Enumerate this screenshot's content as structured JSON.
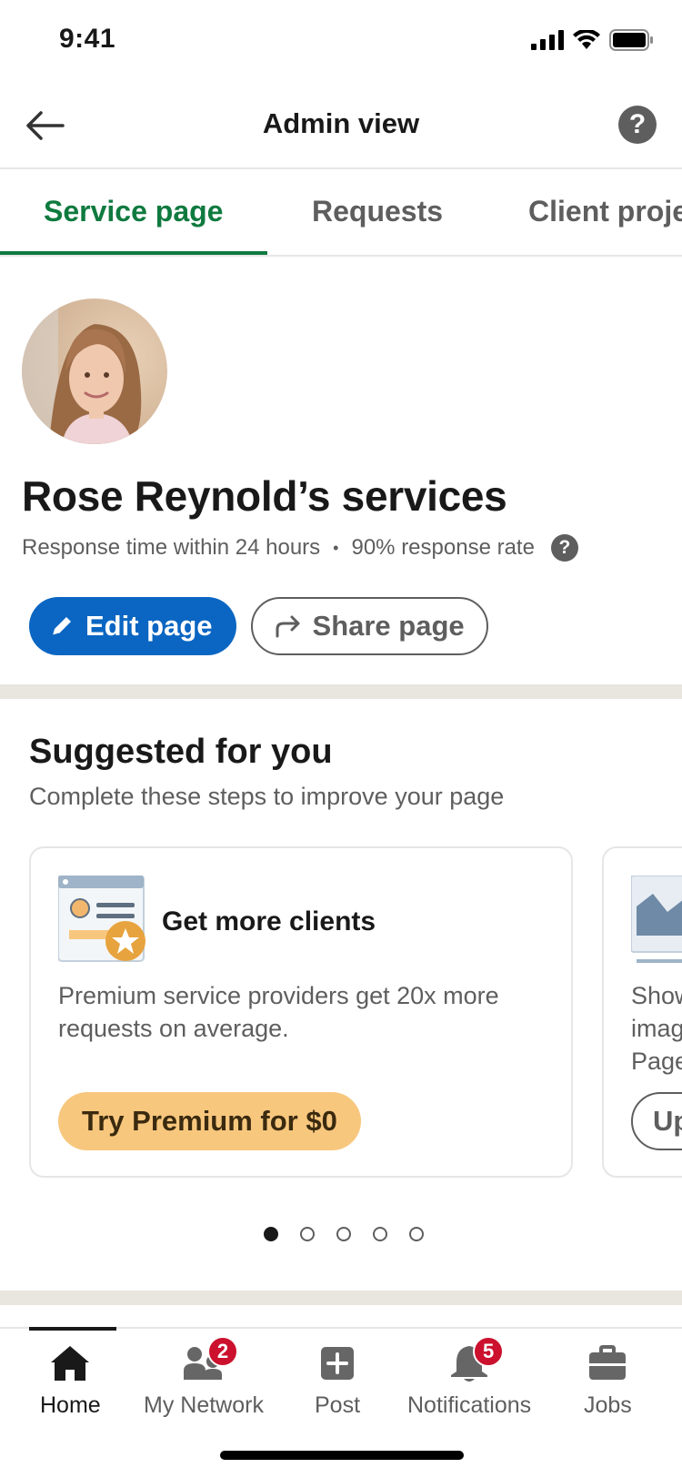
{
  "status_bar": {
    "time": "9:41"
  },
  "header": {
    "title": "Admin view"
  },
  "tabs": [
    {
      "label": "Service page"
    },
    {
      "label": "Requests"
    },
    {
      "label": "Client proje"
    }
  ],
  "profile": {
    "title": "Rose Reynold’s services",
    "response_time": "Response time within 24 hours",
    "separator": "•",
    "response_rate": "90% response rate",
    "edit_label": "Edit page",
    "share_label": "Share page"
  },
  "suggested": {
    "title": "Suggested for you",
    "subtitle": "Complete these steps to improve your page",
    "cards": [
      {
        "title": "Get more clients",
        "text": "Premium service providers get 20x more requests on average.",
        "button": "Try Premium for $0"
      },
      {
        "text_lines": [
          "Show",
          "imag",
          "Page"
        ],
        "button": "Up"
      }
    ],
    "pager": {
      "total": 5,
      "active": 1
    }
  },
  "bottom_nav": {
    "items": [
      {
        "label": "Home",
        "icon": "home-icon",
        "active": true
      },
      {
        "label": "My Network",
        "icon": "network-icon",
        "badge": "2"
      },
      {
        "label": "Post",
        "icon": "post-icon"
      },
      {
        "label": "Notifications",
        "icon": "bell-icon",
        "badge": "5"
      },
      {
        "label": "Jobs",
        "icon": "briefcase-icon"
      }
    ]
  },
  "colors": {
    "active_tab": "#0f7a3f",
    "primary": "#0a66c2",
    "premium": "#f8c77e",
    "badge": "#cb112d"
  }
}
